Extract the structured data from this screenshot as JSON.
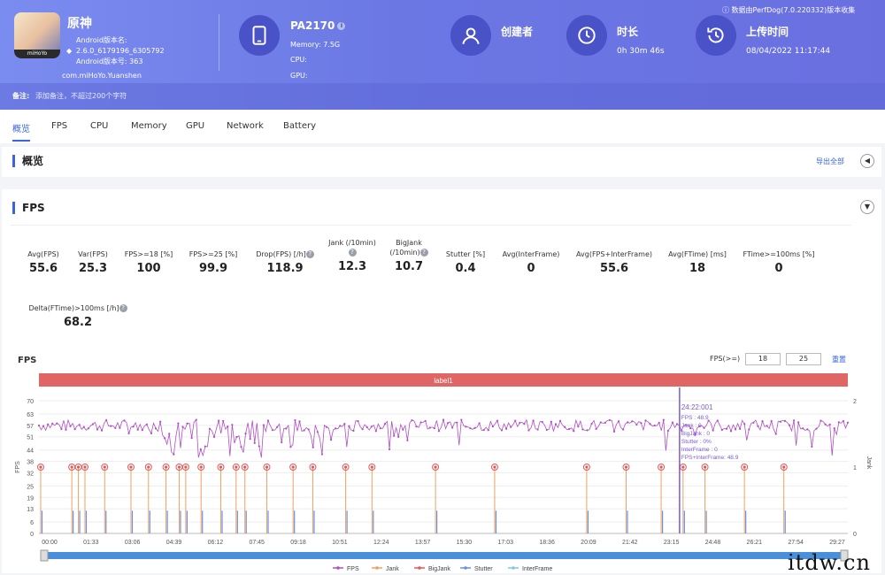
{
  "header": {
    "app_name": "原神",
    "android_version_label": "Android版本名:",
    "android_version_value": "2.6.0_6179196_6305792",
    "android_code": "Android版本号: 363",
    "package": "com.miHoYo.Yuanshen",
    "icon_tag": "miHoYo",
    "device": "PA2170",
    "memory": "Memory: 7.5G",
    "cpu": "CPU:",
    "gpu": "GPU:",
    "creator_label": "创建者",
    "duration_label": "时长",
    "duration_value": "0h 30m 46s",
    "upload_label": "上传时间",
    "upload_value": "08/04/2022 11:17:44",
    "source_note": "数据由PerfDog(7.0.220332)版本收集",
    "note_label": "备注:",
    "note_placeholder": "添加备注，不超过200个字符"
  },
  "tabs": [
    "概览",
    "FPS",
    "CPU",
    "Memory",
    "GPU",
    "Network",
    "Battery"
  ],
  "overview": {
    "title": "概览",
    "export": "导出全部"
  },
  "fps_panel": {
    "title": "FPS",
    "metrics": [
      {
        "label": "Avg(FPS)",
        "value": "55.6"
      },
      {
        "label": "Var(FPS)",
        "value": "25.3"
      },
      {
        "label": "FPS>=18 [%]",
        "value": "100"
      },
      {
        "label": "FPS>=25 [%]",
        "value": "99.9"
      },
      {
        "label": "Drop(FPS) [/h]",
        "value": "118.9"
      },
      {
        "label": "Jank (/10min)",
        "value": "12.3"
      },
      {
        "label": "BigJank (/10min)",
        "value": "10.7"
      },
      {
        "label": "Stutter [%]",
        "value": "0.4"
      },
      {
        "label": "Avg(InterFrame)",
        "value": "0"
      },
      {
        "label": "Avg(FPS+InterFrame)",
        "value": "55.6"
      },
      {
        "label": "Avg(FTime) [ms]",
        "value": "18"
      },
      {
        "label": "FTime>=100ms [%]",
        "value": "0"
      },
      {
        "label": "Delta(FTime)>100ms [/h]",
        "value": "68.2"
      }
    ],
    "chart_title": "FPS",
    "fps_threshold_label": "FPS(>=)",
    "threshold_1": "18",
    "threshold_2": "25",
    "reset": "重置"
  },
  "chart_data": {
    "type": "line",
    "title": "FPS",
    "band_label": "label1",
    "ylabel": "FPS",
    "y2label": "Jank",
    "ylim": [
      0,
      70
    ],
    "y2lim": [
      0,
      2
    ],
    "yticks": [
      0,
      6,
      13,
      19,
      25,
      32,
      38,
      44,
      51,
      57,
      63,
      70
    ],
    "y2ticks": [
      0,
      1,
      2
    ],
    "xticks": [
      "00:00",
      "01:33",
      "03:06",
      "04:39",
      "06:12",
      "07:45",
      "09:18",
      "10:51",
      "12:24",
      "13:57",
      "15:30",
      "17:03",
      "18:36",
      "20:09",
      "21:42",
      "23:15",
      "24:48",
      "26:21",
      "27:54",
      "29:27"
    ],
    "duration_seconds": 1846,
    "series": [
      {
        "name": "FPS",
        "color": "#b04fc4",
        "mean": 57
      },
      {
        "name": "Jank",
        "color": "#f0a060"
      },
      {
        "name": "BigJank",
        "color": "#e05a5a"
      },
      {
        "name": "Stutter",
        "color": "#6b8fe0"
      },
      {
        "name": "InterFrame",
        "color": "#7ec8e8"
      }
    ],
    "jank_times_seconds": [
      4,
      75,
      90,
      105,
      150,
      210,
      250,
      290,
      320,
      335,
      370,
      415,
      450,
      470,
      520,
      580,
      625,
      700,
      760,
      905,
      1040,
      1250,
      1340,
      1420,
      1470,
      1520,
      1610,
      1700
    ],
    "tooltip": {
      "time": "24:22:001",
      "lines": [
        "FPS : 48.9",
        "Jank : 0",
        "BigJank : 0",
        "Stutter : 0%",
        "InterFrame : 0",
        "FPS+InterFrame: 48.9"
      ]
    },
    "legend_position": "bottom"
  }
}
